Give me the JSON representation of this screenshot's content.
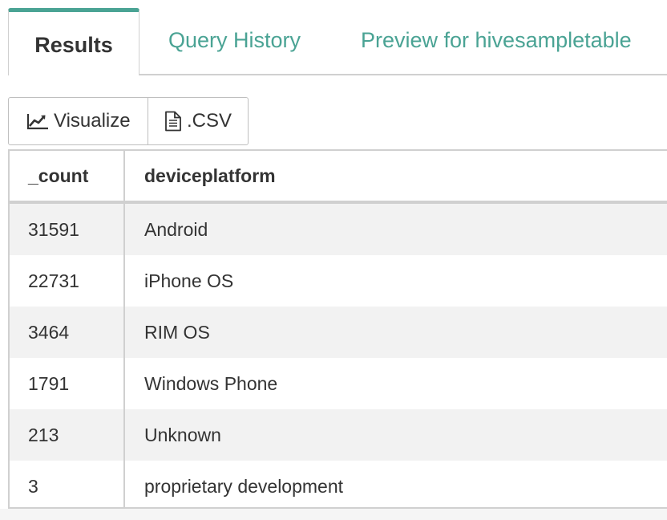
{
  "tabs": [
    {
      "label": "Results",
      "active": true
    },
    {
      "label": "Query History",
      "active": false
    },
    {
      "label": "Preview for hivesampletable",
      "active": false
    }
  ],
  "toolbar": {
    "visualize_label": "Visualize",
    "visualize_icon": "line-chart-icon",
    "csv_label": ".CSV",
    "csv_icon": "document-icon"
  },
  "table": {
    "columns": [
      "_count",
      "deviceplatform"
    ],
    "rows": [
      [
        "31591",
        "Android"
      ],
      [
        "22731",
        "iPhone OS"
      ],
      [
        "3464",
        "RIM OS"
      ],
      [
        "1791",
        "Windows Phone"
      ],
      [
        "213",
        "Unknown"
      ],
      [
        "3",
        "proprietary development"
      ]
    ]
  },
  "colors": {
    "accent": "#4aa394",
    "text": "#333333",
    "border": "#d0d0d0",
    "row_alt": "#f2f2f2"
  }
}
